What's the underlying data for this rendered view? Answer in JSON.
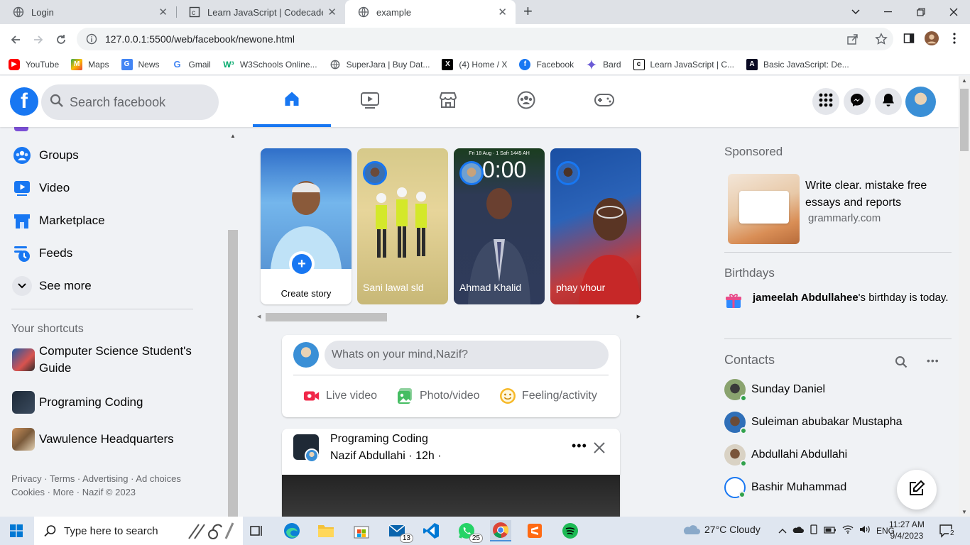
{
  "browser": {
    "tabs": [
      {
        "title": "Login",
        "icon": "globe-icon"
      },
      {
        "title": "Learn JavaScript | Codecademy",
        "icon": "codecademy-icon"
      },
      {
        "title": "example",
        "icon": "globe-icon"
      }
    ],
    "url": "127.0.0.1:5500/web/facebook/newone.html",
    "bookmarks": [
      "YouTube",
      "Maps",
      "News",
      "Gmail",
      "W3Schools Online...",
      "SuperJara | Buy Dat...",
      "(4) Home / X",
      "Facebook",
      "Bard",
      "Learn JavaScript | C...",
      "Basic JavaScript: De..."
    ]
  },
  "header": {
    "search_placeholder": "Search facebook"
  },
  "left": {
    "nav": [
      "Groups",
      "Video",
      "Marketplace",
      "Feeds",
      "See more"
    ],
    "shortcuts_title": "Your shortcuts",
    "shortcuts": [
      "Computer Science Student's Guide",
      "Programing Coding",
      "Vawulence Headquarters"
    ],
    "footer_line1": "Privacy · Terms · Advertising · Ad choices",
    "footer_line2": "Cookies · More · Nazif © 2023"
  },
  "stories": {
    "create_label": "Create story",
    "items": [
      "Sani lawal sld",
      "Ahmad Khalid",
      "phay vhour"
    ],
    "clock_overlay": "0:00",
    "clock_date": "Fri 18 Aug · 1 Safr 1445 AH"
  },
  "composer": {
    "placeholder": "Whats on your mind,Nazif?",
    "actions": [
      "Live video",
      "Photo/video",
      "Feeling/activity"
    ]
  },
  "post": {
    "group": "Programing Coding",
    "meta": "Nazif Abdullahi · 12h ·"
  },
  "right": {
    "sponsored_title": "Sponsored",
    "ad_text": "Write clear. mistake free essays and reports",
    "ad_site": "grammarly.com",
    "birthdays_title": "Birthdays",
    "birthday_name": "jameelah Abdullahee",
    "birthday_text": "'s birthday is today.",
    "contacts_title": "Contacts",
    "contacts": [
      "Sunday Daniel",
      "Suleiman abubakar Mustapha",
      "Abdullahi Abdullahi",
      "Bashir Muhammad"
    ]
  },
  "taskbar": {
    "search_placeholder": "Type here to search",
    "mail_badge": "13",
    "whatsapp_badge": "25",
    "weather": "27°C  Cloudy",
    "lang": "ENG",
    "time": "11:27 AM",
    "date": "9/4/2023",
    "notif_count": "2"
  },
  "colors": {
    "fb_blue": "#1877f2",
    "page_bg": "#f0f2f5",
    "online_green": "#31a24c"
  }
}
